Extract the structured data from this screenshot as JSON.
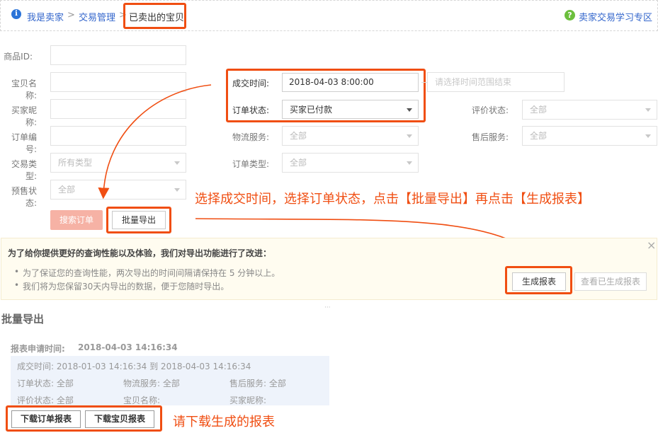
{
  "breadcrumb": {
    "items": [
      "我是卖家",
      "交易管理",
      "已卖出的宝贝"
    ],
    "separator": ">",
    "help_link": "卖家交易学习专区"
  },
  "form": {
    "product_id_label": "商品ID:",
    "item_name_label": "宝贝名称:",
    "buyer_nick_label": "买家昵称:",
    "order_no_label": "订单编号:",
    "trade_type_label": "交易类型:",
    "trade_type_value": "所有类型",
    "presale_label": "预售状态:",
    "presale_value": "全部",
    "deal_time_label": "成交时间:",
    "deal_time_value": "2018-04-03 8:00:00",
    "deal_time_end_placeholder": "请选择时间范围结束",
    "order_status_label": "订单状态:",
    "order_status_value": "买家已付款",
    "logistics_label": "物流服务:",
    "logistics_value": "全部",
    "order_type_label": "订单类型:",
    "order_type_value": "全部",
    "review_status_label": "评价状态:",
    "review_status_value": "全部",
    "after_sale_label": "售后服务:",
    "after_sale_value": "全部",
    "search_button": "搜索订单",
    "export_button": "批量导出"
  },
  "annotations": {
    "top": "选择成交时间，选择订单状态，点击【批量导出】再点击【生成报表】",
    "bottom": "请下载生成的报表"
  },
  "notice": {
    "title": "为了给你提供更好的查询性能以及体验，我们对导出功能进行了改进：",
    "bullets": [
      "为了保证您的查询性能，两次导出的时间间隔请保持在 5 分钟以上。",
      "我们将为您保留30天内导出的数据，便于您随时导出。"
    ],
    "generate_button": "生成报表",
    "view_button": "查看已生成报表",
    "close": "×"
  },
  "export": {
    "section_title": "批量导出",
    "apply_time_label": "报表申请时间:",
    "apply_time_value": "2018-04-03 14:16:34",
    "deal_time_range": "成交时间: 2018-01-03 14:16:34 到 2018-04-03 14:16:34",
    "order_status": "订单状态: 全部",
    "logistics": "物流服务: 全部",
    "after_sale": "售后服务: 全部",
    "review_status": "评价状态: 全部",
    "item_name": "宝贝名称:",
    "buyer_nick": "买家昵称:",
    "download_orders": "下载订单报表",
    "download_items": "下载宝贝报表"
  },
  "colors": {
    "accent_red": "#f04e12",
    "link_blue": "#3366cc"
  }
}
